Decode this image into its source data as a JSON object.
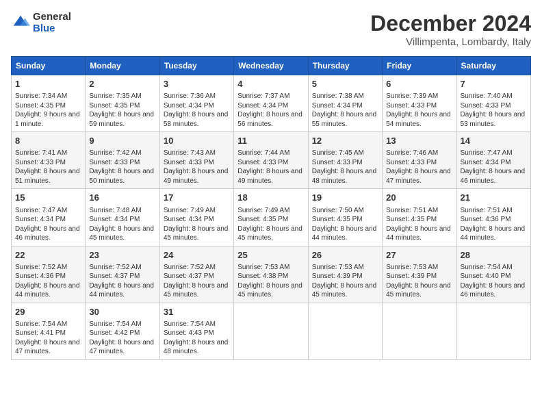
{
  "logo": {
    "general": "General",
    "blue": "Blue"
  },
  "title": "December 2024",
  "subtitle": "Villimpenta, Lombardy, Italy",
  "days_of_week": [
    "Sunday",
    "Monday",
    "Tuesday",
    "Wednesday",
    "Thursday",
    "Friday",
    "Saturday"
  ],
  "weeks": [
    [
      {
        "day": "1",
        "sunrise": "7:34 AM",
        "sunset": "4:35 PM",
        "daylight": "9 hours and 1 minute."
      },
      {
        "day": "2",
        "sunrise": "7:35 AM",
        "sunset": "4:35 PM",
        "daylight": "8 hours and 59 minutes."
      },
      {
        "day": "3",
        "sunrise": "7:36 AM",
        "sunset": "4:34 PM",
        "daylight": "8 hours and 58 minutes."
      },
      {
        "day": "4",
        "sunrise": "7:37 AM",
        "sunset": "4:34 PM",
        "daylight": "8 hours and 56 minutes."
      },
      {
        "day": "5",
        "sunrise": "7:38 AM",
        "sunset": "4:34 PM",
        "daylight": "8 hours and 55 minutes."
      },
      {
        "day": "6",
        "sunrise": "7:39 AM",
        "sunset": "4:33 PM",
        "daylight": "8 hours and 54 minutes."
      },
      {
        "day": "7",
        "sunrise": "7:40 AM",
        "sunset": "4:33 PM",
        "daylight": "8 hours and 53 minutes."
      }
    ],
    [
      {
        "day": "8",
        "sunrise": "7:41 AM",
        "sunset": "4:33 PM",
        "daylight": "8 hours and 51 minutes."
      },
      {
        "day": "9",
        "sunrise": "7:42 AM",
        "sunset": "4:33 PM",
        "daylight": "8 hours and 50 minutes."
      },
      {
        "day": "10",
        "sunrise": "7:43 AM",
        "sunset": "4:33 PM",
        "daylight": "8 hours and 49 minutes."
      },
      {
        "day": "11",
        "sunrise": "7:44 AM",
        "sunset": "4:33 PM",
        "daylight": "8 hours and 49 minutes."
      },
      {
        "day": "12",
        "sunrise": "7:45 AM",
        "sunset": "4:33 PM",
        "daylight": "8 hours and 48 minutes."
      },
      {
        "day": "13",
        "sunrise": "7:46 AM",
        "sunset": "4:33 PM",
        "daylight": "8 hours and 47 minutes."
      },
      {
        "day": "14",
        "sunrise": "7:47 AM",
        "sunset": "4:34 PM",
        "daylight": "8 hours and 46 minutes."
      }
    ],
    [
      {
        "day": "15",
        "sunrise": "7:47 AM",
        "sunset": "4:34 PM",
        "daylight": "8 hours and 46 minutes."
      },
      {
        "day": "16",
        "sunrise": "7:48 AM",
        "sunset": "4:34 PM",
        "daylight": "8 hours and 45 minutes."
      },
      {
        "day": "17",
        "sunrise": "7:49 AM",
        "sunset": "4:34 PM",
        "daylight": "8 hours and 45 minutes."
      },
      {
        "day": "18",
        "sunrise": "7:49 AM",
        "sunset": "4:35 PM",
        "daylight": "8 hours and 45 minutes."
      },
      {
        "day": "19",
        "sunrise": "7:50 AM",
        "sunset": "4:35 PM",
        "daylight": "8 hours and 44 minutes."
      },
      {
        "day": "20",
        "sunrise": "7:51 AM",
        "sunset": "4:35 PM",
        "daylight": "8 hours and 44 minutes."
      },
      {
        "day": "21",
        "sunrise": "7:51 AM",
        "sunset": "4:36 PM",
        "daylight": "8 hours and 44 minutes."
      }
    ],
    [
      {
        "day": "22",
        "sunrise": "7:52 AM",
        "sunset": "4:36 PM",
        "daylight": "8 hours and 44 minutes."
      },
      {
        "day": "23",
        "sunrise": "7:52 AM",
        "sunset": "4:37 PM",
        "daylight": "8 hours and 44 minutes."
      },
      {
        "day": "24",
        "sunrise": "7:52 AM",
        "sunset": "4:37 PM",
        "daylight": "8 hours and 45 minutes."
      },
      {
        "day": "25",
        "sunrise": "7:53 AM",
        "sunset": "4:38 PM",
        "daylight": "8 hours and 45 minutes."
      },
      {
        "day": "26",
        "sunrise": "7:53 AM",
        "sunset": "4:39 PM",
        "daylight": "8 hours and 45 minutes."
      },
      {
        "day": "27",
        "sunrise": "7:53 AM",
        "sunset": "4:39 PM",
        "daylight": "8 hours and 45 minutes."
      },
      {
        "day": "28",
        "sunrise": "7:54 AM",
        "sunset": "4:40 PM",
        "daylight": "8 hours and 46 minutes."
      }
    ],
    [
      {
        "day": "29",
        "sunrise": "7:54 AM",
        "sunset": "4:41 PM",
        "daylight": "8 hours and 47 minutes."
      },
      {
        "day": "30",
        "sunrise": "7:54 AM",
        "sunset": "4:42 PM",
        "daylight": "8 hours and 47 minutes."
      },
      {
        "day": "31",
        "sunrise": "7:54 AM",
        "sunset": "4:43 PM",
        "daylight": "8 hours and 48 minutes."
      },
      null,
      null,
      null,
      null
    ]
  ],
  "labels": {
    "sunrise": "Sunrise:",
    "sunset": "Sunset:",
    "daylight": "Daylight:"
  }
}
